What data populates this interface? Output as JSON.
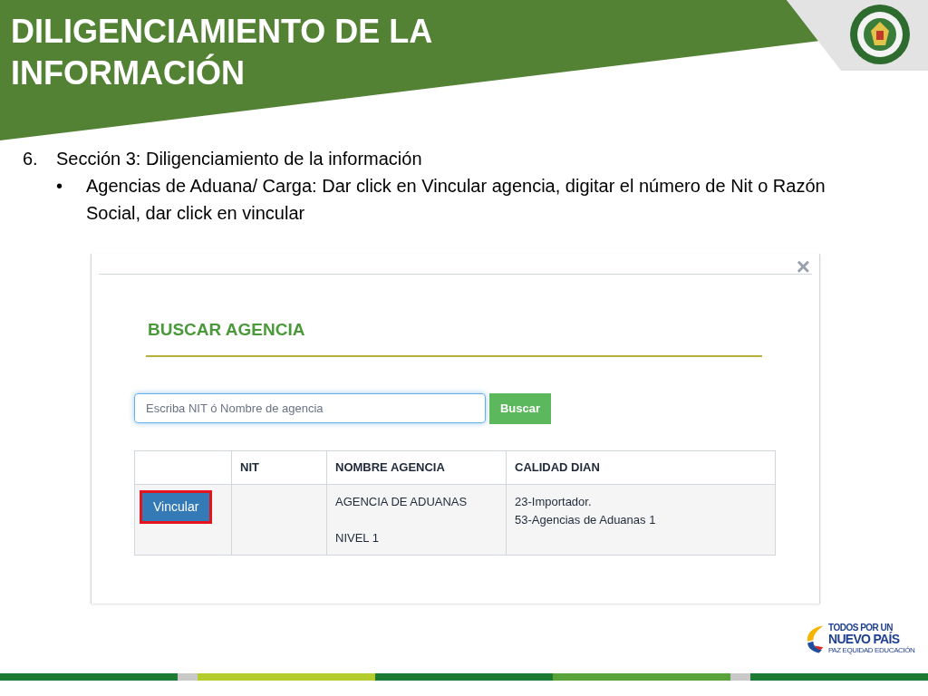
{
  "header": {
    "title": "DILIGENCIAMIENTO DE LA INFORMACIÓN"
  },
  "content": {
    "items": [
      {
        "number": "6.",
        "text": "Sección 3: Diligenciamiento de la información",
        "children": [
          {
            "marker": "•",
            "text": "Agencias de Aduana/ Carga: Dar click en Vincular agencia, digitar el número de Nit o Razón Social, dar click en vincular"
          }
        ]
      }
    ]
  },
  "dialog": {
    "close": "×",
    "title": "BUSCAR AGENCIA",
    "search": {
      "placeholder": "Escriba NIT ó Nombre de agencia"
    },
    "search_button": "Buscar",
    "table": {
      "columns": [
        "NIT",
        "NOMBRE AGENCIA",
        "CALIDAD DIAN"
      ],
      "rows": [
        {
          "action": "Vincular",
          "highlighted": true,
          "nombre_agencia": [
            "AGENCIA DE ADUANAS",
            "NIVEL 1"
          ],
          "calidad_dian": [
            "23-Importador.",
            "53-Agencias de Aduanas 1"
          ]
        }
      ]
    }
  },
  "footer_logo": {
    "lines": [
      "TODOS POR UN",
      "NUEVO PAÍS",
      "PAZ EQUIDAD EDUCACIÓN"
    ]
  }
}
